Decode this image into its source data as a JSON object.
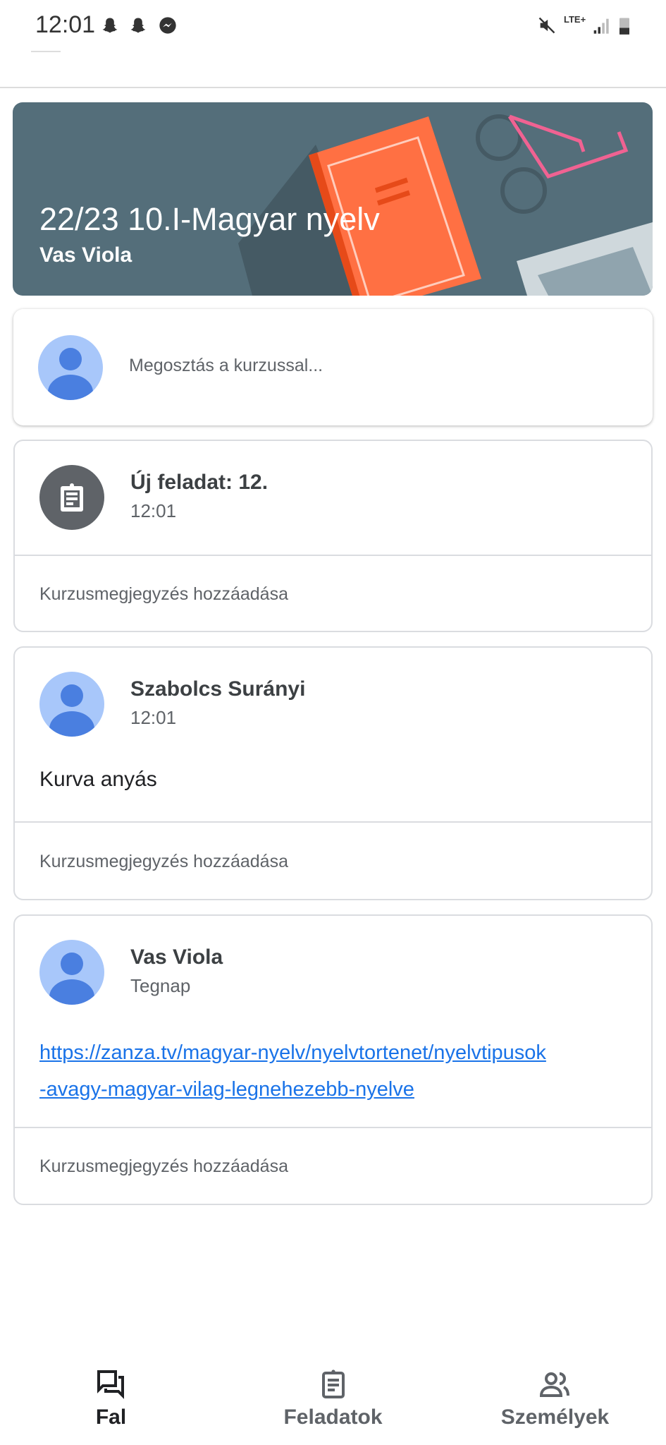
{
  "status_bar": {
    "time": "12:01",
    "notification_icons": [
      "snapchat-icon",
      "snapchat-icon",
      "messenger-icon"
    ],
    "network": "LTE+"
  },
  "banner": {
    "title": "22/23 10.I-Magyar nyelv",
    "teacher": "Vas Viola",
    "background": "#546e7a"
  },
  "share": {
    "placeholder": "Megosztás a kurzussal..."
  },
  "posts": [
    {
      "title": "Új feladat: 12.",
      "time": "12:01",
      "icon": "assignment-icon",
      "comment": "Kurzusmegjegyzés hozzáadása"
    },
    {
      "title": "Szabolcs Surányi",
      "time": "12:01",
      "body": "Kurva anyás",
      "comment": "Kurzusmegjegyzés hozzáadása"
    },
    {
      "title": "Vas Viola",
      "time": "Tegnap",
      "link_line1": "https://zanza.tv/magyar-nyelv/nyelvtortenet/nyelvtipusok",
      "link_line2": "-avagy-magyar-vilag-legnehezebb-nyelve",
      "comment": "Kurzusmegjegyzés hozzáadása"
    }
  ],
  "bottom_nav": [
    {
      "label": "Fal",
      "active": true
    },
    {
      "label": "Feladatok"
    },
    {
      "label": "Személyek"
    }
  ],
  "colors": {
    "link": "#1a73e8",
    "avatar_bg": "#a8c7fa",
    "avatar_fg": "#4a7fe0"
  }
}
